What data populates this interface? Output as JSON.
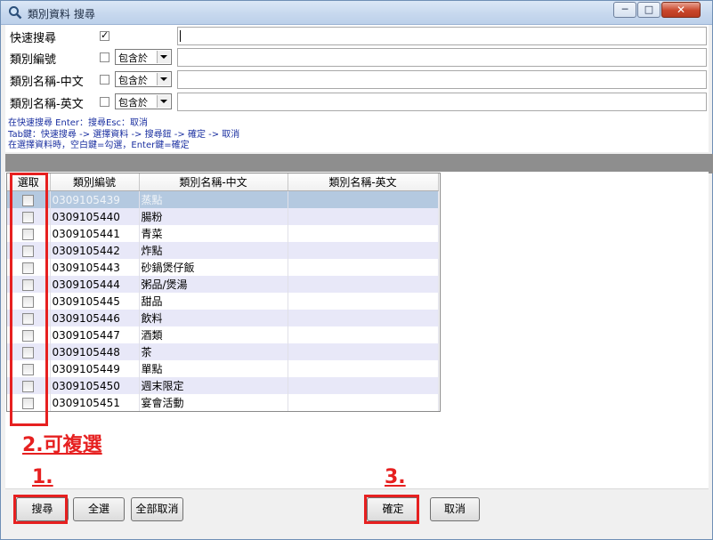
{
  "window": {
    "title": "類別資料 搜尋",
    "controls": {
      "minimize": "─",
      "maximize": "□",
      "close": "✕"
    }
  },
  "search": {
    "rows": [
      {
        "label": "快速搜尋",
        "checked": true,
        "has_operator": false,
        "operator": "",
        "value": ""
      },
      {
        "label": "類別編號",
        "checked": false,
        "has_operator": true,
        "operator": "包含於",
        "value": ""
      },
      {
        "label": "類別名稱-中文",
        "checked": false,
        "has_operator": true,
        "operator": "包含於",
        "value": ""
      },
      {
        "label": "類別名稱-英文",
        "checked": false,
        "has_operator": true,
        "operator": "包含於",
        "value": ""
      }
    ],
    "hints": [
      "在快速搜尋 Enter：搜尋Esc：取消",
      "Tab鍵：快速搜尋 -> 選擇資料 -> 搜尋鈕 -> 確定 -> 取消",
      "在選擇資料時，空白鍵=勾選，Enter鍵=確定"
    ]
  },
  "grid": {
    "columns": [
      "選取",
      "類別編號",
      "類別名稱-中文",
      "類別名稱-英文"
    ],
    "rows": [
      {
        "code": "0309105439",
        "name_zh": "蒸點",
        "name_en": "",
        "checked": false,
        "selected": true
      },
      {
        "code": "0309105440",
        "name_zh": "腸粉",
        "name_en": "",
        "checked": false,
        "selected": false
      },
      {
        "code": "0309105441",
        "name_zh": "青菜",
        "name_en": "",
        "checked": false,
        "selected": false
      },
      {
        "code": "0309105442",
        "name_zh": "炸點",
        "name_en": "",
        "checked": false,
        "selected": false
      },
      {
        "code": "0309105443",
        "name_zh": "砂鍋煲仔飯",
        "name_en": "",
        "checked": false,
        "selected": false
      },
      {
        "code": "0309105444",
        "name_zh": "粥品/煲湯",
        "name_en": "",
        "checked": false,
        "selected": false
      },
      {
        "code": "0309105445",
        "name_zh": "甜品",
        "name_en": "",
        "checked": false,
        "selected": false
      },
      {
        "code": "0309105446",
        "name_zh": "飲料",
        "name_en": "",
        "checked": false,
        "selected": false
      },
      {
        "code": "0309105447",
        "name_zh": "酒類",
        "name_en": "",
        "checked": false,
        "selected": false
      },
      {
        "code": "0309105448",
        "name_zh": "茶",
        "name_en": "",
        "checked": false,
        "selected": false
      },
      {
        "code": "0309105449",
        "name_zh": "單點",
        "name_en": "",
        "checked": false,
        "selected": false
      },
      {
        "code": "0309105450",
        "name_zh": "週末限定",
        "name_en": "",
        "checked": false,
        "selected": false
      },
      {
        "code": "0309105451",
        "name_zh": "宴會活動",
        "name_en": "",
        "checked": false,
        "selected": false
      }
    ]
  },
  "annotations": {
    "step1": "1.",
    "step2": "2.可複選",
    "step3": "3.",
    "color": "#e62020"
  },
  "buttons": {
    "search": "搜尋",
    "select_all": "全選",
    "deselect_all": "全部取消",
    "ok": "確定",
    "cancel": "取消"
  }
}
